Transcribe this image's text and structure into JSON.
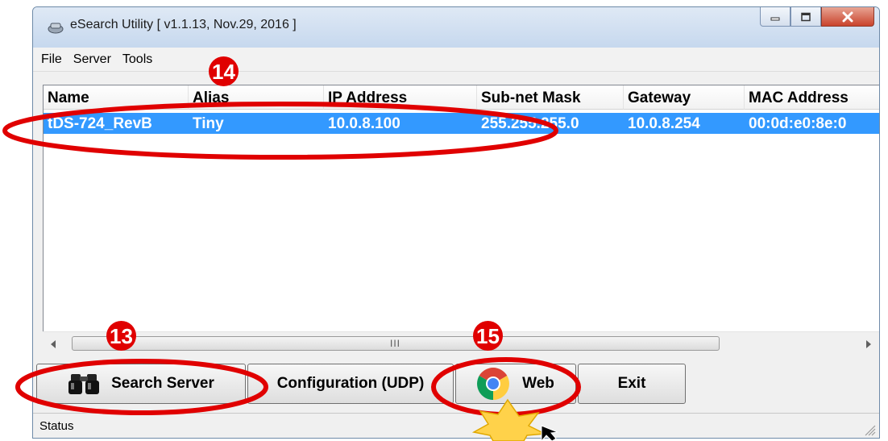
{
  "window": {
    "title": "eSearch Utility [ v1.1.13, Nov.29, 2016 ]",
    "minimize_label": "minimize",
    "maximize_label": "maximize",
    "close_label": "close"
  },
  "menu": [
    {
      "label": "File"
    },
    {
      "label": "Server"
    },
    {
      "label": "Tools"
    }
  ],
  "table": {
    "columns": [
      "Name",
      "Alias",
      "IP Address",
      "Sub-net Mask",
      "Gateway",
      "MAC Address"
    ],
    "rows": [
      {
        "selected": true,
        "cells": [
          "tDS-724_RevB",
          "Tiny",
          "10.0.8.100",
          "255.255.255.0",
          "10.0.8.254",
          "00:0d:e0:8e:0"
        ]
      }
    ]
  },
  "scrollbar": {
    "grip": "III"
  },
  "buttons": {
    "search_server": "Search Server",
    "configuration": "Configuration (UDP)",
    "web": "Web",
    "exit": "Exit"
  },
  "status": {
    "text": "Status"
  },
  "annotations": [
    {
      "label": "14"
    },
    {
      "label": "13"
    },
    {
      "label": "15"
    }
  ],
  "colors": {
    "selection": "#3399ff",
    "annotation_red": "#e00000",
    "titlebar": "#c6d8ee"
  }
}
